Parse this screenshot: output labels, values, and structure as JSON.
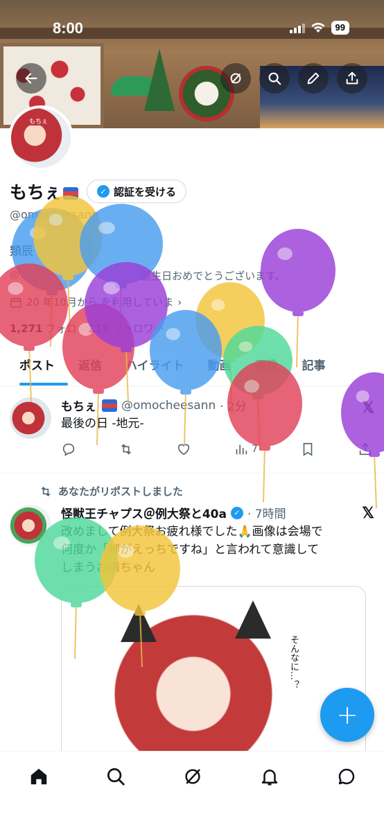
{
  "status_bar": {
    "time": "8:00",
    "battery": "99"
  },
  "profile": {
    "display_name": "もちぇ",
    "verify_label": "認証を受ける",
    "handle": "@omocheesann",
    "bio": "類辰",
    "birthday": "誕生日おめでとうございます。",
    "joined": "20 年10月から を利用していま",
    "following_count": "1,271",
    "followers_count": "112",
    "following_label": "フォロ",
    "followers_label": "フォロワー"
  },
  "tabs": [
    "ポスト",
    "返信",
    "ハイライト",
    "動画",
    "画像",
    "記事"
  ],
  "tweets": [
    {
      "name": "もちぇ",
      "handle": "@omocheesann",
      "time": "· 2分",
      "text": "最後の日 -地元-",
      "views": "7"
    },
    {
      "repost_label": "あなたがリポストしました",
      "name": "怪獣王チャプス＠例大祭と40a",
      "time": "· 7時間",
      "text_lines": [
        "改めまして例大祭お疲れ様でした🙏画像は会場で",
        "何度か「脚がえっちですね」と言われて意識して",
        "しまうお燐ちゃん"
      ],
      "media_note": "そんなに…？"
    }
  ],
  "balloon_colors": {
    "red": "#e2415a",
    "blue": "#4a9df0",
    "yellow": "#f3c53a",
    "purple": "#9a3fd8",
    "green": "#4fd99a"
  },
  "accent": "#1d9bf0"
}
